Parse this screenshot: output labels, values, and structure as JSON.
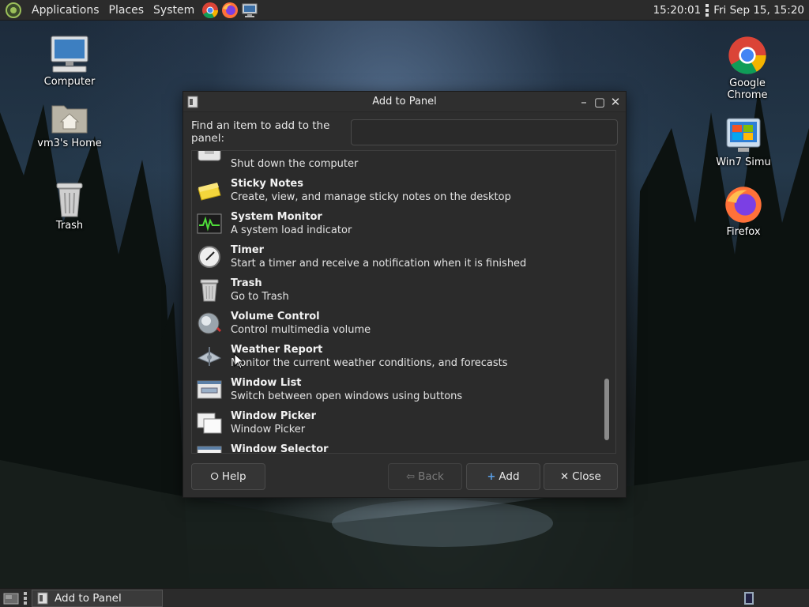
{
  "top_panel": {
    "menus": [
      "Applications",
      "Places",
      "System"
    ],
    "launchers": [
      "chrome-icon",
      "firefox-icon",
      "computer-icon"
    ],
    "time": "15:20:01",
    "datetime": "Fri Sep 15, 15:20"
  },
  "desktop": {
    "icons": [
      {
        "label": "Computer",
        "icon": "computer-icon"
      },
      {
        "label": "vm3's Home",
        "icon": "home-folder-icon"
      },
      {
        "label": "Trash",
        "icon": "trash-icon"
      },
      {
        "label": "Google Chrome",
        "icon": "chrome-icon"
      },
      {
        "label": "Win7 Simu",
        "icon": "win7-icon"
      },
      {
        "label": "Firefox",
        "icon": "firefox-icon"
      }
    ]
  },
  "dialog": {
    "title": "Add to Panel",
    "find_label": "Find an item to add to the panel:",
    "find_value": "",
    "items": [
      {
        "name": "",
        "desc": "Shut down the computer",
        "icon": "shutdown-icon"
      },
      {
        "name": "Sticky Notes",
        "desc": "Create, view, and manage sticky notes on the desktop",
        "icon": "sticky-notes-icon"
      },
      {
        "name": "System Monitor",
        "desc": "A system load indicator",
        "icon": "system-monitor-icon"
      },
      {
        "name": "Timer",
        "desc": "Start a timer and receive a notification when it is finished",
        "icon": "timer-icon"
      },
      {
        "name": "Trash",
        "desc": "Go to Trash",
        "icon": "trash-icon"
      },
      {
        "name": "Volume Control",
        "desc": "Control multimedia volume",
        "icon": "volume-icon"
      },
      {
        "name": "Weather Report",
        "desc": "Monitor the current weather conditions, and forecasts",
        "icon": "weather-icon"
      },
      {
        "name": "Window List",
        "desc": "Switch between open windows using buttons",
        "icon": "window-list-icon"
      },
      {
        "name": "Window Picker",
        "desc": "Window Picker",
        "icon": "window-picker-icon"
      },
      {
        "name": "Window Selector",
        "desc": "",
        "icon": "window-selector-icon"
      }
    ],
    "scroll_position_fraction": 0.75,
    "buttons": {
      "help": "Help",
      "back": "Back",
      "add": "Add",
      "close": "Close"
    }
  },
  "bottom_panel": {
    "task_label": "Add to Panel"
  }
}
